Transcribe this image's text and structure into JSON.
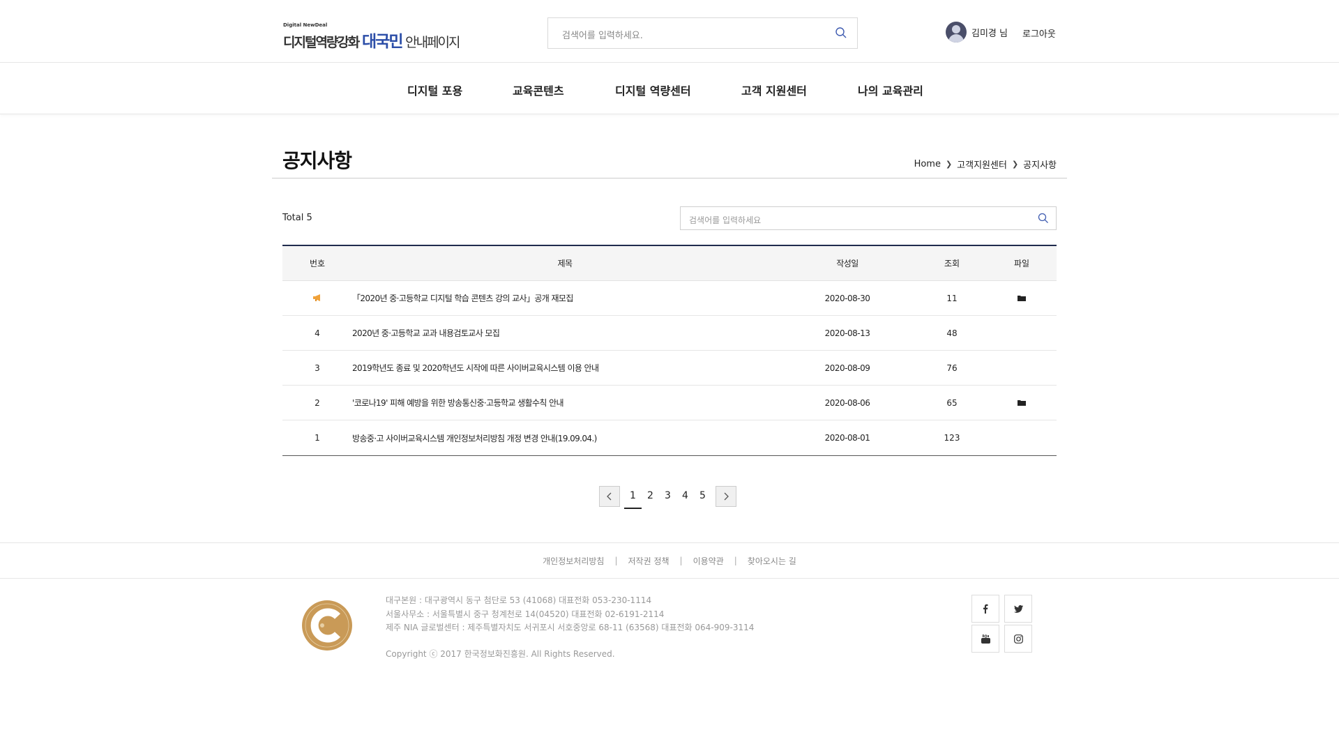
{
  "header": {
    "logo_small": "Digital NewDeal",
    "logo_part1": "디지털역량강화",
    "logo_part2": "대국민",
    "logo_part3": "안내페이지",
    "search_placeholder": "검색어를 입력하세요.",
    "user_name": "김미경 님",
    "logout_label": "로그아웃"
  },
  "nav": {
    "items": [
      {
        "label": "디지털 포용"
      },
      {
        "label": "교육콘텐츠"
      },
      {
        "label": "디지털 역량센터"
      },
      {
        "label": "고객 지원센터"
      },
      {
        "label": "나의 교육관리"
      }
    ]
  },
  "page": {
    "title": "공지사항",
    "breadcrumb": [
      "Home",
      "고객지원센터",
      "공지사항"
    ]
  },
  "list": {
    "total_label": "Total 5",
    "search_placeholder": "검색어를 입력하세요",
    "columns": {
      "no": "번호",
      "title": "제목",
      "date": "작성일",
      "views": "조회",
      "file": "파일"
    },
    "rows": [
      {
        "no": "",
        "notice": true,
        "title": "「2020년 중·고등학교 디지털 학습 콘텐츠 강의 교사」공개 재모집",
        "date": "2020-08-30",
        "views": "11",
        "file": true
      },
      {
        "no": "4",
        "notice": false,
        "title": "2020년 중·고등학교 교과 내용검토교사 모집",
        "date": "2020-08-13",
        "views": "48",
        "file": false
      },
      {
        "no": "3",
        "notice": false,
        "title": "2019학년도 종료 및 2020학년도 시작에 따른 사이버교육시스템 이용 안내",
        "date": "2020-08-09",
        "views": "76",
        "file": false
      },
      {
        "no": "2",
        "notice": false,
        "title": "'코로나19' 피해 예방을 위한 방송통신중·고등학교 생활수칙 안내",
        "date": "2020-08-06",
        "views": "65",
        "file": true
      },
      {
        "no": "1",
        "notice": false,
        "title": "방송중·고 사이버교육시스템 개인정보처리방침 개정 변경 안내(19.09.04.)",
        "date": "2020-08-01",
        "views": "123",
        "file": false
      }
    ]
  },
  "pagination": {
    "pages": [
      "1",
      "2",
      "3",
      "4",
      "5"
    ],
    "current": "1"
  },
  "footer": {
    "links": [
      "개인정보처리방침",
      "저작권 정책",
      "이용약관",
      "찾아오시는 길"
    ],
    "info": [
      "대구본원 : 대구광역시 동구 첨단로 53 (41068) 대표전화 053-230-1114",
      "서울사무소 : 서울특별시 중구 청계천로 14(04520) 대표전화 02-6191-2114",
      "제주 NIA 글로벌센터 : 제주특별자치도 서귀포시 서호중앙로 68-11 (63568) 대표전화 064-909-3114"
    ],
    "copyright": "Copyright ⓒ 2017 한국정보화진흥원. All Rights Reserved.",
    "social": [
      "facebook-icon",
      "twitter-icon",
      "youtube-icon",
      "instagram-icon"
    ]
  },
  "colors": {
    "brand_blue": "#2c4ea8",
    "table_top_border": "#1f2b4d",
    "notice_orange": "#f0a23a",
    "footer_logo_gold": "#c99a57"
  }
}
